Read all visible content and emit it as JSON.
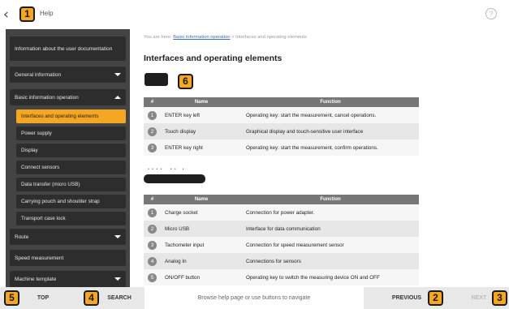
{
  "header": {
    "back_glyph": "‹",
    "title": "Help",
    "help_glyph": "?"
  },
  "badges": [
    "1",
    "6",
    "5",
    "4",
    "2",
    "3"
  ],
  "sidebar": {
    "items": [
      {
        "label": "Information about the user documentation"
      },
      {
        "label": "General information"
      },
      {
        "label": "Basic information operation"
      },
      {
        "label": "Route"
      },
      {
        "label": "Speed measurement"
      },
      {
        "label": "Machine template"
      }
    ],
    "subitems": [
      {
        "label": "Interfaces and operating elements"
      },
      {
        "label": "Power supply"
      },
      {
        "label": "Display"
      },
      {
        "label": "Connect sensors"
      },
      {
        "label": "Data transfer (micro USB)"
      },
      {
        "label": "Carrying pouch and shoulder strap"
      },
      {
        "label": "Transport case lock"
      }
    ]
  },
  "content": {
    "breadcrumb_prefix": "You are here:",
    "breadcrumb_link": "Basic information operation",
    "breadcrumb_sep": ">",
    "breadcrumb_current": "Interfaces and operating elements",
    "title": "Interfaces and operating elements",
    "table1": {
      "headers": [
        "#",
        "Name",
        "Function"
      ],
      "rows": [
        {
          "num": "1",
          "name": "ENTER key left",
          "function": "Operating key: start the measurement, cancel operations."
        },
        {
          "num": "2",
          "name": "Touch display",
          "function": "Graphical display and touch-sensitive user interface"
        },
        {
          "num": "3",
          "name": "ENTER key right",
          "function": "Operating key: start the measurement, confirm operations."
        }
      ]
    },
    "table2": {
      "headers": [
        "#",
        "Name",
        "Function"
      ],
      "rows": [
        {
          "num": "1",
          "name": "Charge socket",
          "function": "Connection for power adapter."
        },
        {
          "num": "2",
          "name": "Micro USB",
          "function": "Interface for data communication"
        },
        {
          "num": "3",
          "name": "Tachometer input",
          "function": "Connection for speed measurement sensor"
        },
        {
          "num": "4",
          "name": "Analog In",
          "function": "Connections for sensors"
        },
        {
          "num": "5",
          "name": "ON/OFF button",
          "function": "Operating key to switch the measuring device ON and OFF"
        }
      ]
    }
  },
  "footer": {
    "top": "TOP",
    "search": "SEARCH",
    "hint": "Browse help page or use buttons to navigate",
    "previous": "PREVIOUS",
    "next": "NEXT"
  },
  "colors": {
    "accent": "#f5a623",
    "sidebar_bg": "#444444",
    "sidebar_item": "#2d2d2d",
    "table_header": "#777777",
    "link": "#3a6fb5"
  }
}
